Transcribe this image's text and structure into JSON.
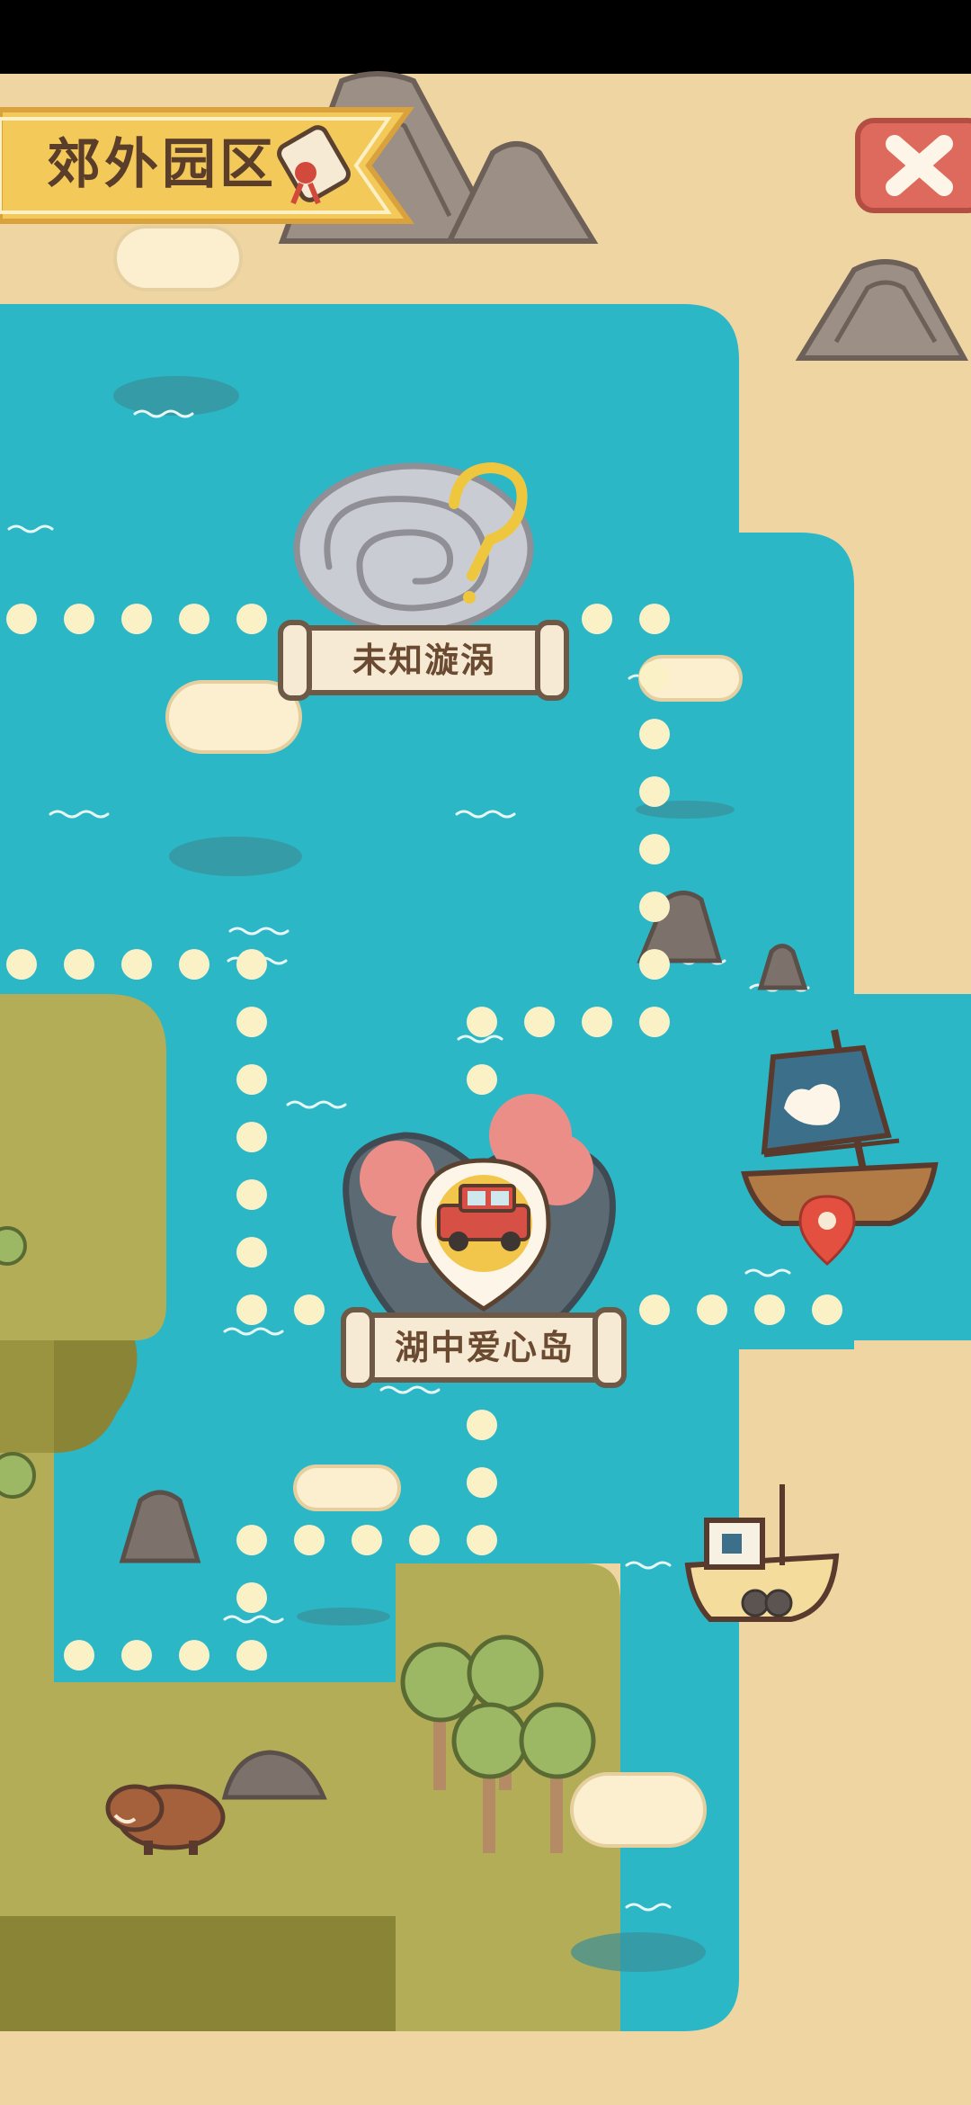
{
  "header": {
    "area_title": "郊外园区",
    "title_icon": "scroll-map-icon",
    "close_icon": "close-x-icon"
  },
  "map": {
    "nodes": [
      {
        "label": "未知漩涡",
        "icon": "whirlpool-unknown-icon",
        "locked": true
      },
      {
        "label": "湖中爱心岛",
        "icon": "heart-island-icon",
        "current": true,
        "marker_icon": "jeep-vehicle-icon"
      }
    ],
    "landmarks": [
      "sailboat-cat-flag-icon",
      "location-pin-icon",
      "fishing-boat-icon",
      "wild-boar-icon",
      "tree-icon",
      "rock-icon",
      "mountain-icon",
      "cloud-icon"
    ]
  },
  "colors": {
    "water": "#2bb7c6",
    "sand": "#efd5a2",
    "grass": "#b3ad57",
    "grass_dark": "#8a8436",
    "path_dot": "#fbf1c6",
    "badge": "#f3c95a",
    "close_button": "#dd6a5c"
  }
}
